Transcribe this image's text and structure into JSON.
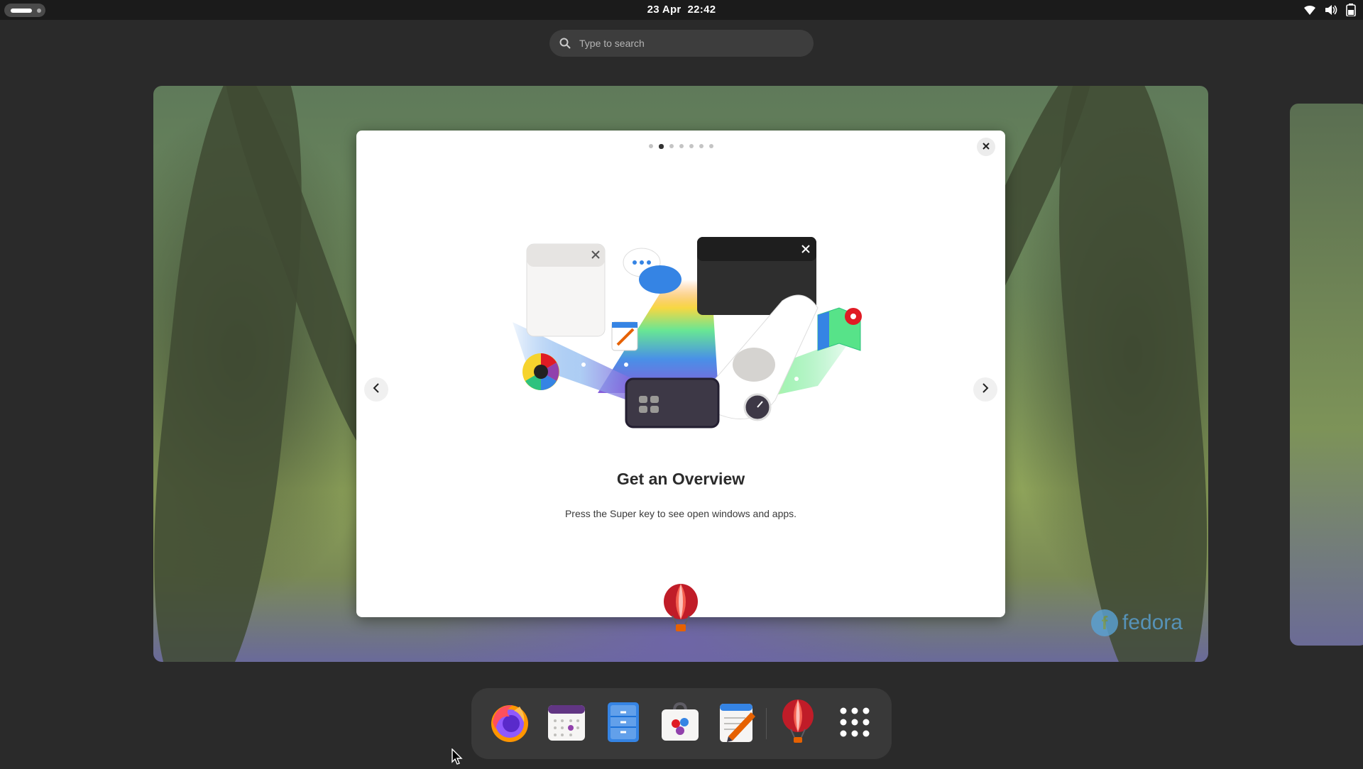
{
  "topbar": {
    "clock_date": "23 Apr",
    "clock_time": "22:42",
    "tray_icons": [
      "wifi-icon",
      "volume-icon",
      "battery-icon"
    ]
  },
  "search": {
    "placeholder": "Type to search"
  },
  "workspace": {
    "watermark": "fedora"
  },
  "dialog": {
    "page_count": 7,
    "active_page_index": 1,
    "title": "Get an Overview",
    "subtitle": "Press the Super key to see open windows and apps."
  },
  "dock": {
    "apps": [
      {
        "name": "Firefox",
        "icon": "firefox-icon"
      },
      {
        "name": "Calendar",
        "icon": "calendar-icon"
      },
      {
        "name": "Files",
        "icon": "files-icon"
      },
      {
        "name": "Software",
        "icon": "software-icon"
      },
      {
        "name": "Text Editor",
        "icon": "text-editor-icon"
      },
      {
        "name": "Tour",
        "icon": "balloon-icon"
      },
      {
        "name": "Show Apps",
        "icon": "app-grid-icon"
      }
    ]
  },
  "colors": {
    "accent_blue": "#3584e4",
    "balloon_red": "#c01c28",
    "panel_bg": "#1b1b1b",
    "dock_bg": "#393939"
  }
}
